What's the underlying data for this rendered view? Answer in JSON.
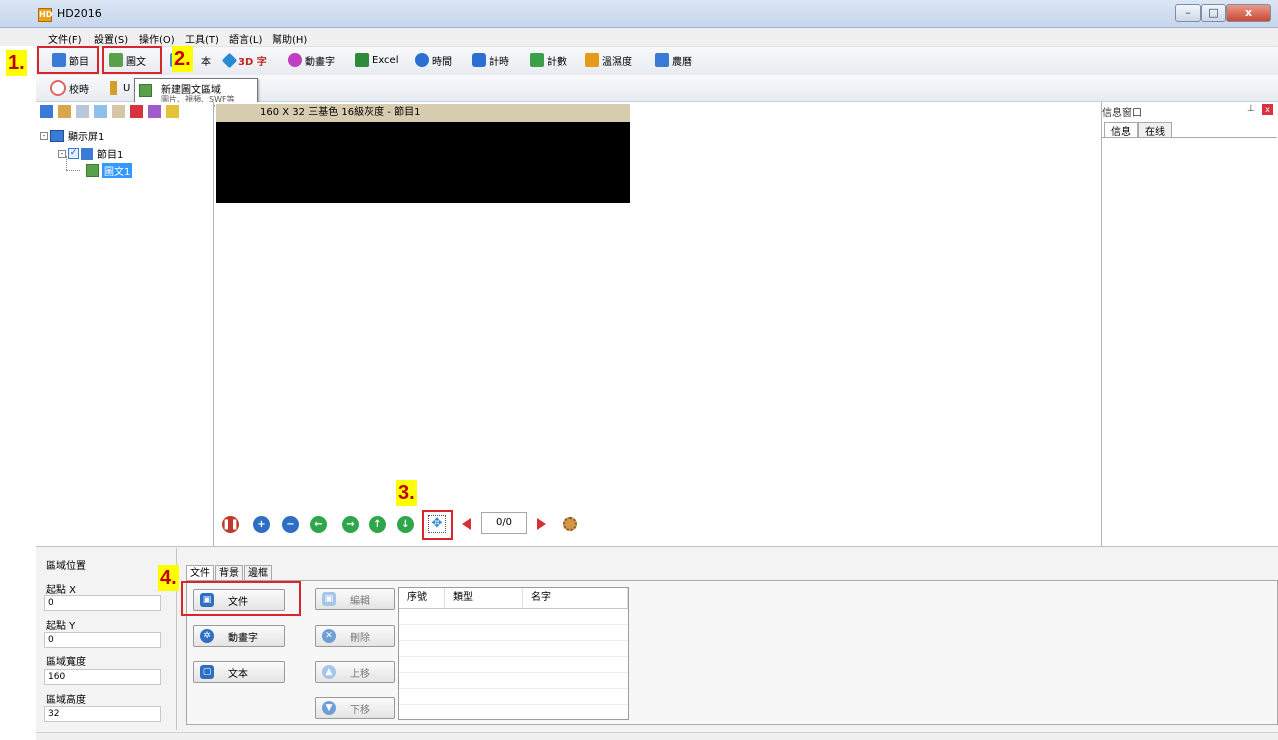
{
  "window": {
    "title": "HD2016",
    "controls": [
      "–",
      "□",
      "x"
    ],
    "app_icon": "HD"
  },
  "menu": [
    "文件(F)",
    "設置(S)",
    "操作(O)",
    "工具(T)",
    "語言(L)",
    "幫助(H)"
  ],
  "toolbar": {
    "items": [
      {
        "label": "節目",
        "icon": "program-icon",
        "color": "#3b7bd8"
      },
      {
        "label": "圖文",
        "icon": "image-text-icon",
        "color": "#5aa04a"
      },
      {
        "label": "本",
        "icon": "text-icon",
        "color": "#4f86c9"
      },
      {
        "label": "3D 字",
        "icon": "cube-icon",
        "color": "#2a8ad4"
      },
      {
        "label": "動畫字",
        "icon": "animation-icon",
        "color": "#c03fc0"
      },
      {
        "label": "Excel",
        "icon": "excel-icon",
        "color": "#2f8a3c"
      },
      {
        "label": "時間",
        "icon": "clock-icon",
        "color": "#2b6fd1"
      },
      {
        "label": "計時",
        "icon": "timer-icon",
        "color": "#2b6fd1"
      },
      {
        "label": "計數",
        "icon": "counter-icon",
        "color": "#3aa04a"
      },
      {
        "label": "溫濕度",
        "icon": "thermometer-icon",
        "color": "#e59a1a"
      },
      {
        "label": "農曆",
        "icon": "calendar-icon",
        "color": "#3b7bd8"
      }
    ],
    "row2": [
      {
        "label": "校時",
        "icon": "clock-sync-icon"
      },
      {
        "label": "U",
        "icon": "usb-icon"
      }
    ]
  },
  "tooltip": {
    "title": "新建圖文區域",
    "subtitle": "圖片、視頻、SWF等"
  },
  "steps": [
    "1.",
    "2.",
    "3.",
    "4."
  ],
  "tree": {
    "screen": "顯示屏1",
    "program": "節目1",
    "area": "圖文1"
  },
  "canvas": {
    "header": "160 X 32 三基色 16級灰度 - 節目1",
    "page_counter": "0/0"
  },
  "info_panel": {
    "title": "信息窗口",
    "tabs": [
      "信息",
      "在线"
    ]
  },
  "region": {
    "title": "區域位置",
    "fields": [
      {
        "label": "起點 X",
        "value": "0"
      },
      {
        "label": "起點 Y",
        "value": "0"
      },
      {
        "label": "區域寬度",
        "value": "160"
      },
      {
        "label": "區域高度",
        "value": "32"
      }
    ]
  },
  "bottom_tabs": [
    "文件",
    "背景",
    "邊框"
  ],
  "add_buttons": [
    "文件",
    "動畫字",
    "文本"
  ],
  "action_buttons": [
    "編輯",
    "刪除",
    "上移",
    "下移"
  ],
  "table": {
    "columns": [
      "序號",
      "類型",
      "名字"
    ]
  }
}
